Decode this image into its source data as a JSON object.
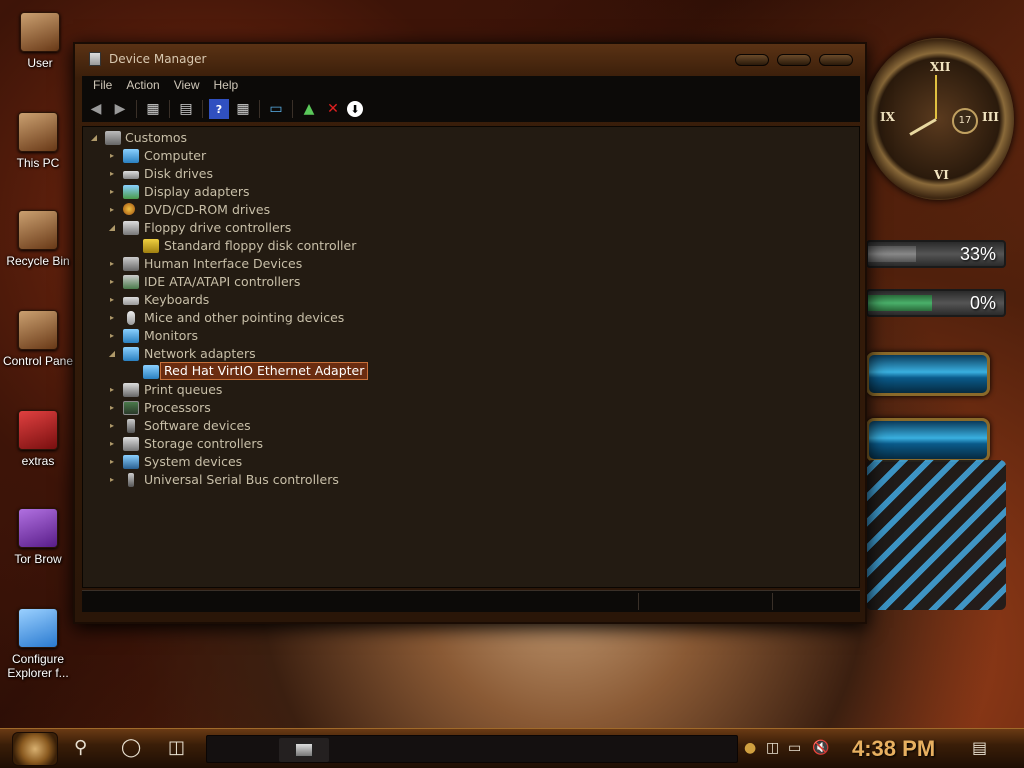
{
  "desktop": {
    "icons": [
      {
        "label": "User"
      },
      {
        "label": "This PC"
      },
      {
        "label": "Recycle Bin"
      },
      {
        "label": "Control Pane"
      },
      {
        "label": "extras"
      },
      {
        "label": "Tor Brow"
      },
      {
        "label": "Configure Explorer f..."
      }
    ]
  },
  "widgets": {
    "clock_day": "17",
    "cpu_percent": "33%",
    "ram_percent": "0%",
    "cpu_level": 0.33,
    "ram_level": 0.0
  },
  "window": {
    "title": "Device Manager",
    "menu": [
      "File",
      "Action",
      "View",
      "Help"
    ],
    "toolbar_icons": [
      "back-arrow-icon",
      "forward-arrow-icon",
      "properties-icon",
      "list-icon",
      "help-icon",
      "details-icon",
      "monitor-icon",
      "enable-device-icon",
      "uninstall-x-icon",
      "update-driver-icon"
    ]
  },
  "tree": {
    "root": "Customos",
    "nodes": [
      {
        "label": "Computer",
        "expanded": false
      },
      {
        "label": "Disk drives",
        "expanded": false
      },
      {
        "label": "Display adapters",
        "expanded": false
      },
      {
        "label": "DVD/CD-ROM drives",
        "expanded": false
      },
      {
        "label": "Floppy drive controllers",
        "expanded": true,
        "children": [
          "Standard floppy disk controller"
        ]
      },
      {
        "label": "Human Interface Devices",
        "expanded": false
      },
      {
        "label": "IDE ATA/ATAPI controllers",
        "expanded": false
      },
      {
        "label": "Keyboards",
        "expanded": false
      },
      {
        "label": "Mice and other pointing devices",
        "expanded": false
      },
      {
        "label": "Monitors",
        "expanded": false
      },
      {
        "label": "Network adapters",
        "expanded": true,
        "children": [
          "Red Hat VirtIO Ethernet Adapter"
        ]
      },
      {
        "label": "Print queues",
        "expanded": false
      },
      {
        "label": "Processors",
        "expanded": false
      },
      {
        "label": "Software devices",
        "expanded": false
      },
      {
        "label": "Storage controllers",
        "expanded": false
      },
      {
        "label": "System devices",
        "expanded": false
      },
      {
        "label": "Universal Serial Bus controllers",
        "expanded": false
      }
    ],
    "selected": "Red Hat VirtIO Ethernet Adapter"
  },
  "taskbar": {
    "time": "4:38 PM"
  },
  "colors": {
    "selection_bg": "#6a2c10",
    "selection_border": "#c8703a",
    "tree_text": "#c8bfa8",
    "clock_text": "#e8b060"
  }
}
